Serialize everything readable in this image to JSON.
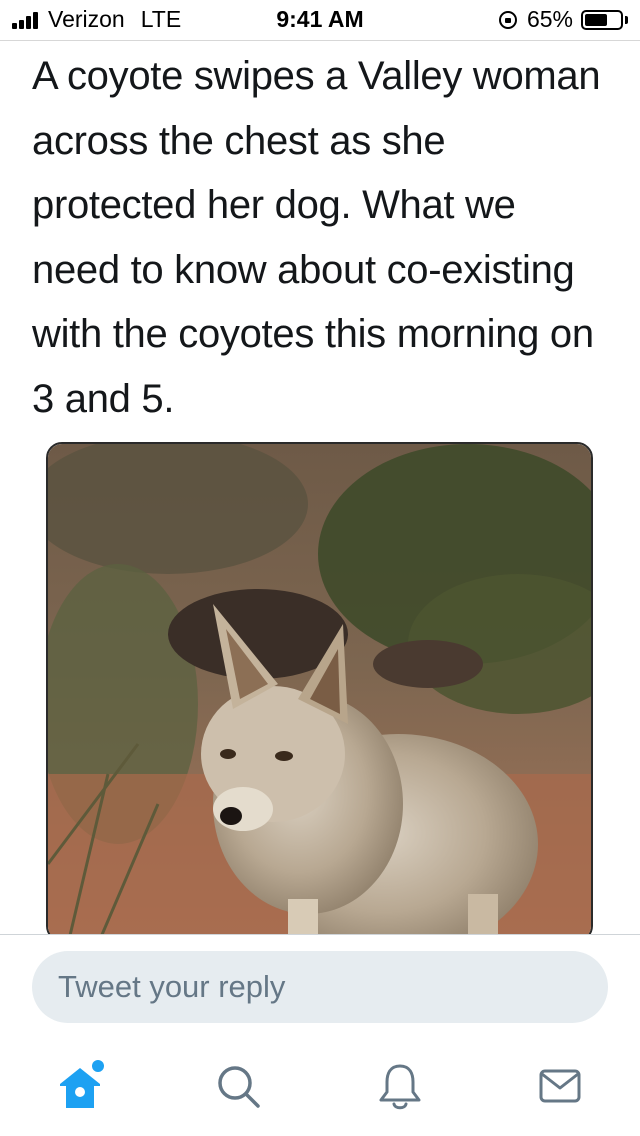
{
  "status_bar": {
    "carrier": "Verizon",
    "network": "LTE",
    "time": "9:41 AM",
    "battery_percent": "65%",
    "battery_level": 0.65
  },
  "tweet": {
    "text": "A coyote swipes a Valley woman across the chest as she protected her dog. What we need to know about co-existing with the coyotes this morning on 3 and 5."
  },
  "reply": {
    "placeholder": "Tweet your reply"
  },
  "tab_bar": {
    "items": [
      {
        "name": "home",
        "icon": "home-icon",
        "active": true
      },
      {
        "name": "search",
        "icon": "search-icon",
        "active": false
      },
      {
        "name": "notifications",
        "icon": "bell-icon",
        "active": false
      },
      {
        "name": "messages",
        "icon": "envelope-icon",
        "active": false
      }
    ]
  },
  "colors": {
    "accent": "#1da1f2",
    "icon_gray": "#657786",
    "reply_bg": "#e6ecf0",
    "text": "#14171a"
  }
}
